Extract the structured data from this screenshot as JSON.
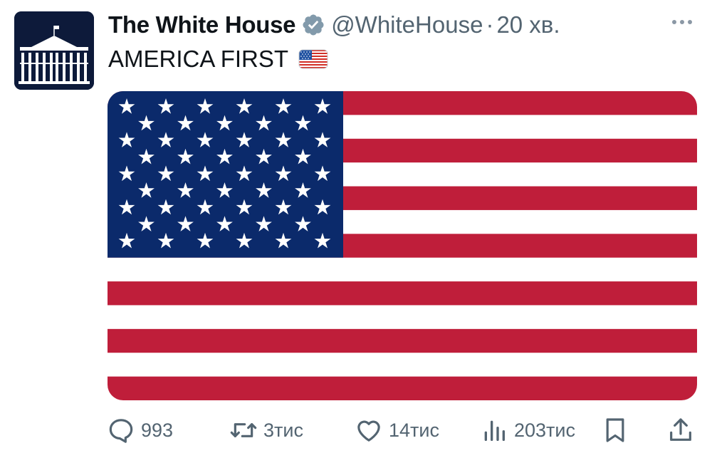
{
  "post": {
    "display_name": "The White House",
    "handle": "@WhiteHouse",
    "separator": "·",
    "time": "20 хв.",
    "text": "AMERICA FIRST",
    "text_emoji": "us-flag-emoji",
    "media": "us-flag-image"
  },
  "actions": {
    "replies": "993",
    "reposts": "3тис",
    "likes": "14тис",
    "views": "203тис"
  },
  "colors": {
    "flag_red": "#bf1e3a",
    "flag_blue": "#0b2a6b",
    "verified_badge": "#829aab",
    "secondary_text": "#536471",
    "avatar_bg": "#0d1a3a"
  },
  "icons": [
    "verified-badge-icon",
    "more-icon",
    "reply-icon",
    "repost-icon",
    "like-icon",
    "views-icon",
    "bookmark-icon",
    "share-icon"
  ]
}
